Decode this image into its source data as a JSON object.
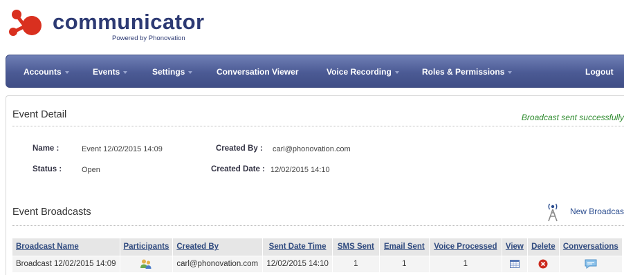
{
  "brand": {
    "name": "communicator",
    "tagline": "Powered by Phonovation"
  },
  "nav": {
    "accounts": "Accounts",
    "events": "Events",
    "settings": "Settings",
    "conversation_viewer": "Conversation Viewer",
    "voice_recording": "Voice Recording",
    "roles_permissions": "Roles & Permissions",
    "logout": "Logout"
  },
  "event_detail": {
    "title": "Event Detail",
    "success_message": "Broadcast sent successfully",
    "name_label": "Name :",
    "name_value": "Event 12/02/2015 14:09",
    "status_label": "Status :",
    "status_value": "Open",
    "created_by_label": "Created By :",
    "created_by_value": "carl@phonovation.com",
    "created_date_label": "Created Date :",
    "created_date_value": "12/02/2015 14:10"
  },
  "broadcasts": {
    "title": "Event Broadcasts",
    "new_broadcast": "New Broadcas",
    "columns": {
      "name": "Broadcast Name",
      "participants": "Participants",
      "created_by": "Created By",
      "sent": "Sent Date Time",
      "sms": "SMS Sent",
      "email": "Email Sent",
      "voice": "Voice Processed",
      "view": "View",
      "delete": "Delete",
      "conversations": "Conversations"
    },
    "rows": [
      {
        "name": "Broadcast 12/02/2015 14:09",
        "created_by": "carl@phonovation.com",
        "sent": "12/02/2015 14:10",
        "sms": "1",
        "email": "1",
        "voice": "1"
      }
    ]
  },
  "icons": [
    "logo-mark-icon",
    "participants-icon",
    "view-icon",
    "delete-icon",
    "conversations-icon",
    "broadcast-tower-icon"
  ],
  "colors": {
    "brand": "#2d3a73",
    "accent_red": "#d9301f",
    "nav": "#4b5a94",
    "success": "#2e8b2e",
    "link": "#2f4a7f"
  }
}
